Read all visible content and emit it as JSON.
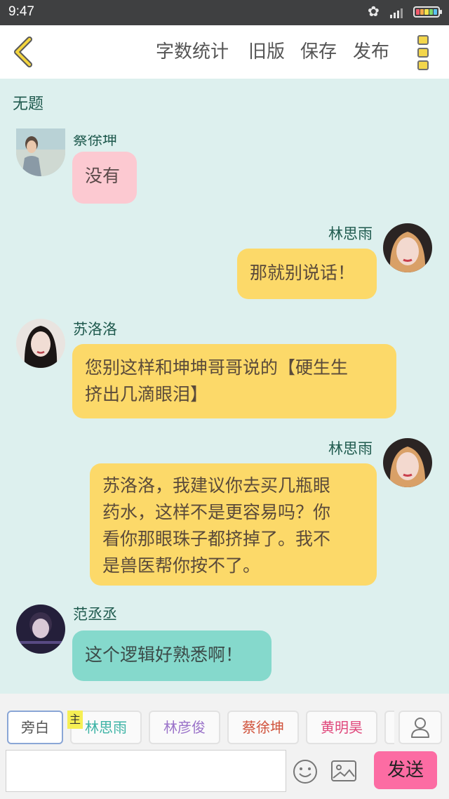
{
  "status_bar": {
    "time": "9:47",
    "battery_colors": [
      "#f25a6b",
      "#f5a94a",
      "#f4e34b",
      "#7ad86a",
      "#5bc2f0"
    ]
  },
  "toolbar": {
    "back_icon": "chevron-left-icon",
    "actions": [
      "字数统计",
      "旧版",
      "保存",
      "发布"
    ],
    "menu_icon": "more-vertical-icon"
  },
  "story": {
    "title": "无题"
  },
  "messages": [
    {
      "sender": "蔡徐坤",
      "side": "left",
      "color": "pink",
      "text": "没有"
    },
    {
      "sender": "林思雨",
      "side": "right",
      "color": "yellow",
      "text": "那就别说话！"
    },
    {
      "sender": "苏洛洛",
      "side": "left",
      "color": "yellow",
      "lines": [
        "您别这样和坤坤哥哥说的【硬生生",
        "挤出几滴眼泪】"
      ]
    },
    {
      "sender": "林思雨",
      "side": "right",
      "color": "yellow",
      "lines": [
        "苏洛洛，我建议你去买几瓶眼",
        "药水，这样不是更容易吗？你",
        "看你那眼珠子都挤掉了。我不",
        "是兽医帮你按不了。"
      ]
    },
    {
      "sender": "范丞丞",
      "side": "left",
      "color": "teal",
      "text": "这个逻辑好熟悉啊！"
    }
  ],
  "composer": {
    "characters": [
      {
        "label": "旁白",
        "color": "#555555"
      },
      {
        "label": "林思雨",
        "color": "#3cb3a5",
        "tag": "主"
      },
      {
        "label": "林彦俊",
        "color": "#9a72c9"
      },
      {
        "label": "蔡徐坤",
        "color": "#d0533c"
      },
      {
        "label": "黄明昊",
        "color": "#e0487c"
      }
    ],
    "add_character_icon": "person-icon",
    "input_value": "",
    "emoji_icon": "smiley-icon",
    "image_icon": "image-icon",
    "send_label": "发送"
  }
}
